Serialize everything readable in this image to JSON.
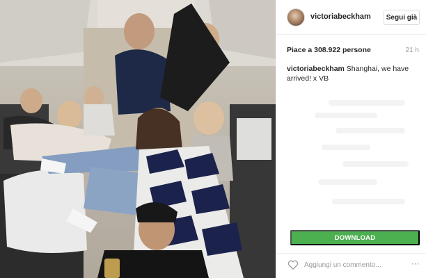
{
  "post": {
    "username": "victoriabeckham",
    "follow_label": "Segui già",
    "likes": "Piace a 308.922 persone",
    "time_ago": "21 h",
    "caption_user": "victoriabeckham",
    "caption_text": " Shanghai, we have arrived! x VB",
    "download_label": "DOWNLOAD",
    "comment_placeholder": "Aggiungi un commento...",
    "more_glyph": "···"
  },
  "photo": {
    "description_icon": "group-photo-airplane-cabin"
  },
  "colors": {
    "download_green": "#4caf50",
    "border": "#efefef",
    "muted_text": "#999999"
  }
}
